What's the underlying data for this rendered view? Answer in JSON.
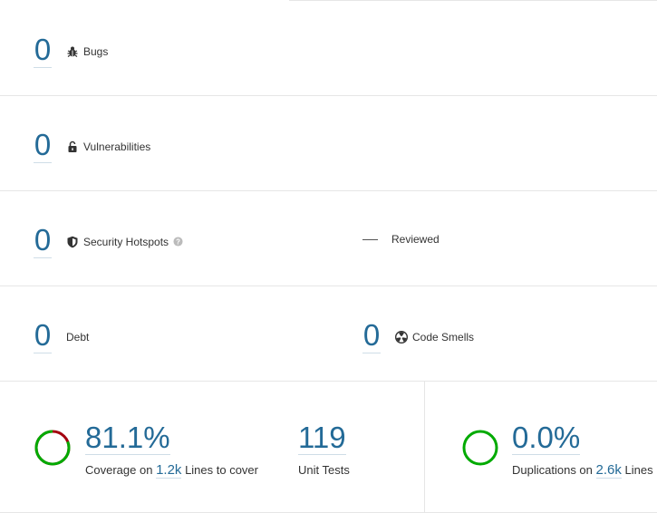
{
  "reliability": {
    "count": "0",
    "label": "Bugs"
  },
  "security": {
    "count": "0",
    "label": "Vulnerabilities"
  },
  "hotspots": {
    "count": "0",
    "label": "Security Hotspots",
    "reviewed_value": "—",
    "reviewed_label": "Reviewed"
  },
  "maintainability": {
    "debt_count": "0",
    "debt_label": "Debt",
    "smells_count": "0",
    "smells_label": "Code Smells"
  },
  "coverage": {
    "percent": "81.1%",
    "prefix": "Coverage on",
    "lines": "1.2k",
    "suffix": "Lines to cover",
    "value_fraction": 0.811,
    "colors": {
      "covered": "#00aa00",
      "uncovered": "#a4030f"
    }
  },
  "tests": {
    "count": "119",
    "label": "Unit Tests"
  },
  "duplications": {
    "percent": "0.0%",
    "prefix": "Duplications on",
    "lines": "2.6k",
    "suffix": "Lines",
    "color": "#00aa00"
  },
  "colors": {
    "accent": "#236a97",
    "border": "#e6e6e6"
  }
}
